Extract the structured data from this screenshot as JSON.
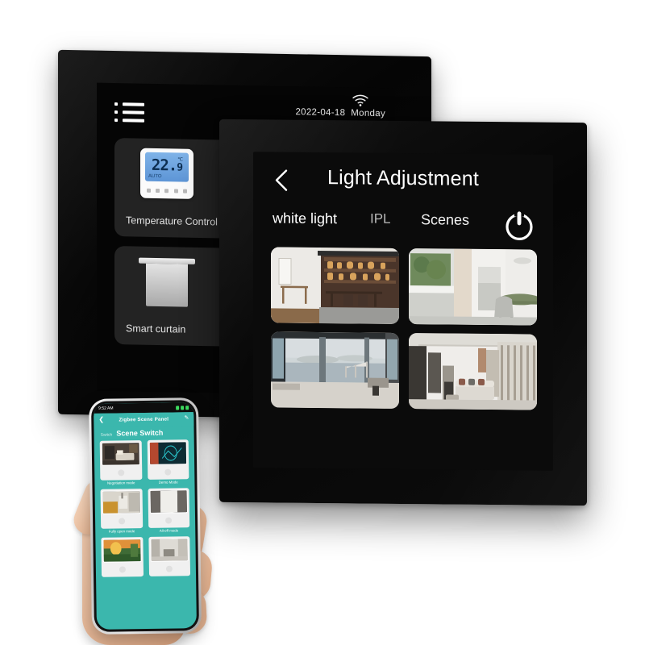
{
  "scene": {
    "background_color": "#ffffff",
    "accent_green": "#15ad2e",
    "accent_blue": "#12a9e8",
    "phone_teal": "#3bb7ad"
  },
  "back_panel": {
    "name": "Smart wall switch home screen",
    "menu_icon": "list-menu-icon",
    "wifi_icon": "wifi-icon",
    "date": "2022-04-18",
    "weekday": "Monday",
    "devices": [
      {
        "label": "Temperature Control",
        "icon": "thermostat-icon",
        "toggle_on": true,
        "value": "22.",
        "value_decimal": "9",
        "unit": "℃",
        "mode_text": "AUTO"
      },
      {
        "label": "Smart curtain",
        "icon": "curtain-icon",
        "toggle_on": true
      }
    ],
    "signal_badge": "wireless-signal-icon"
  },
  "front_panel": {
    "name": "Light Adjustment screen",
    "back_icon": "back-chevron-icon",
    "title": "Light Adjustment",
    "power_icon": "power-icon",
    "tabs": [
      {
        "label": "white light",
        "active": true
      },
      {
        "label": "IPL",
        "active": false
      },
      {
        "label": "Scenes",
        "active": true
      }
    ],
    "scenes": [
      {
        "name": "tea-room-scene"
      },
      {
        "name": "dining-kitchen-scene"
      },
      {
        "name": "sea-view-scene"
      },
      {
        "name": "living-room-scene"
      }
    ]
  },
  "phone": {
    "status_bar": {
      "time": "9:52 AM",
      "battery_icon": "battery-icon",
      "signal_icon": "signal-icon",
      "wifi_icon": "wifi-icon"
    },
    "nav": {
      "back_icon": "back-chevron-icon",
      "title": "Zigbee Scene Panel",
      "edit_icon": "edit-pencil-icon"
    },
    "subtitle": {
      "small": "Switch",
      "big": "Scene Switch"
    },
    "cards": [
      {
        "label": "Negotiation mode",
        "thumb": "bedroom-thumb"
      },
      {
        "label": "Demo Mode",
        "thumb": "presentation-thumb"
      },
      {
        "label": "Fully open mode",
        "thumb": "kitchen-thumb"
      },
      {
        "label": "All-off mode",
        "thumb": "curtain-thumb"
      },
      {
        "label": "",
        "thumb": "garden-thumb"
      },
      {
        "label": "",
        "thumb": "corridor-thumb"
      }
    ]
  }
}
